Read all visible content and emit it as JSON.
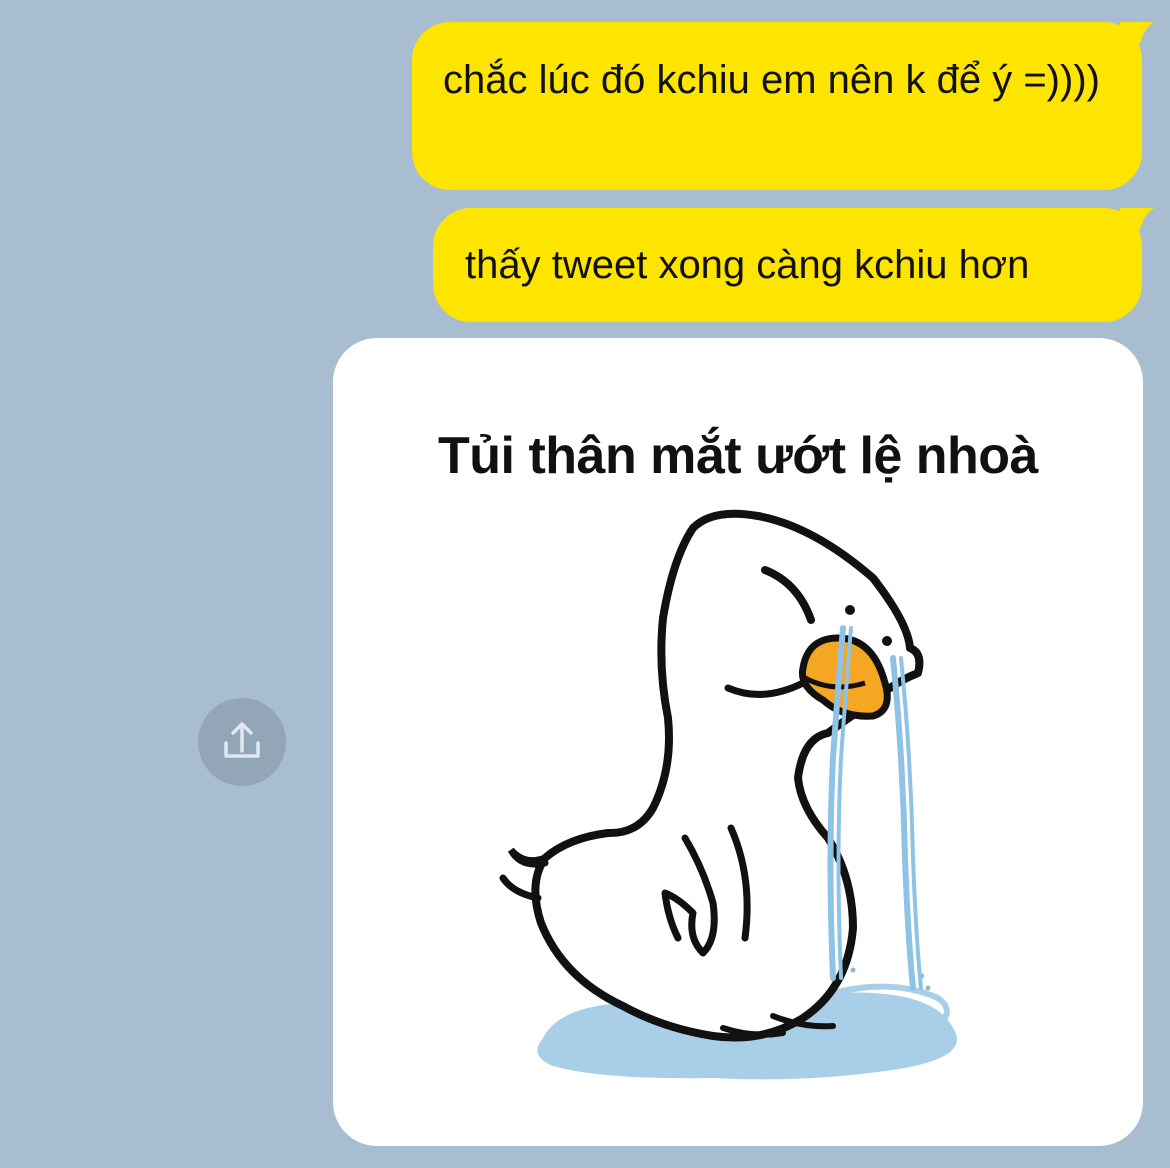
{
  "theme": {
    "chat_background": "#a9bdd1",
    "outgoing_bubble": "#fee500",
    "share_button_bg": "#93a6b8",
    "share_icon_color": "#dfe7ef"
  },
  "messages": [
    {
      "type": "text",
      "direction": "outgoing",
      "text": "chắc lúc đó kchiu em nên k để ý =))))"
    },
    {
      "type": "text",
      "direction": "outgoing",
      "text": "thấy tweet xong càng kchiu hơn"
    },
    {
      "type": "sticker",
      "direction": "outgoing",
      "caption": "Tủi thân mắt ướt lệ nhoà",
      "icon": "crying-duck-sticker"
    }
  ],
  "share_button": {
    "icon": "share-icon"
  }
}
